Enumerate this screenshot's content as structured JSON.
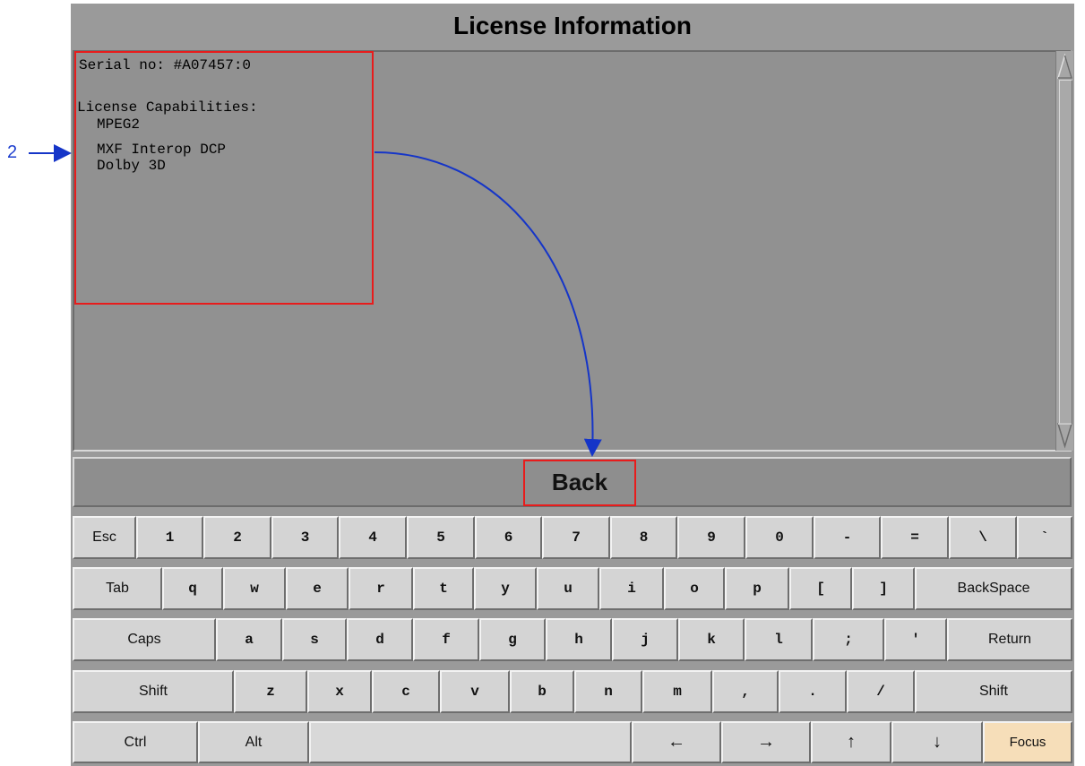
{
  "window": {
    "title": "License Information"
  },
  "license": {
    "serial": "Serial no: #A07457:0",
    "capabilities_label": "License Capabilities:",
    "capabilities": [
      "MPEG2",
      "MXF Interop DCP",
      "Dolby 3D"
    ]
  },
  "back_button": "Back",
  "annotation": {
    "number": "2"
  },
  "colors": {
    "highlight": "#e81c1c",
    "arrow": "#1535c8",
    "focus_key": "#f6deb9"
  },
  "keyboard": {
    "row1": [
      "Esc",
      "1",
      "2",
      "3",
      "4",
      "5",
      "6",
      "7",
      "8",
      "9",
      "0",
      "-",
      "=",
      "\\",
      "`"
    ],
    "row2": [
      "Tab",
      "q",
      "w",
      "e",
      "r",
      "t",
      "y",
      "u",
      "i",
      "o",
      "p",
      "[",
      "]",
      "BackSpace"
    ],
    "row3": [
      "Caps",
      "a",
      "s",
      "d",
      "f",
      "g",
      "h",
      "j",
      "k",
      "l",
      ";",
      "'",
      "Return"
    ],
    "row4": [
      "Shift",
      "z",
      "x",
      "c",
      "v",
      "b",
      "n",
      "m",
      ",",
      ".",
      "/",
      "Shift"
    ],
    "row5": [
      "Ctrl",
      "Alt",
      "",
      "←",
      "→",
      "↑",
      "↓",
      "Focus"
    ]
  }
}
